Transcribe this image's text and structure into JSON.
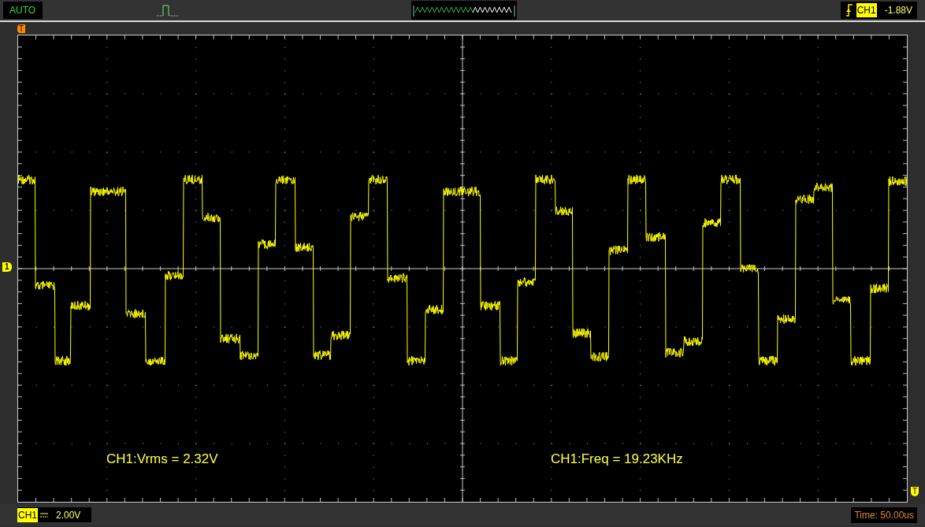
{
  "top_bar": {
    "mode": "AUTO",
    "trigger": {
      "channel": "CH1",
      "level": "-1.88V"
    }
  },
  "markers": {
    "trigger_position": "T",
    "channel_ground": "1",
    "trigger_level": "T"
  },
  "measurements": [
    {
      "text": "CH1:Vrms = 2.32V"
    },
    {
      "text": "CH1:Freq = 19.23KHz"
    }
  ],
  "bottom_bar": {
    "channel": "CH1",
    "scale": "2.00V",
    "timebase": "Time: 50.00us"
  }
}
